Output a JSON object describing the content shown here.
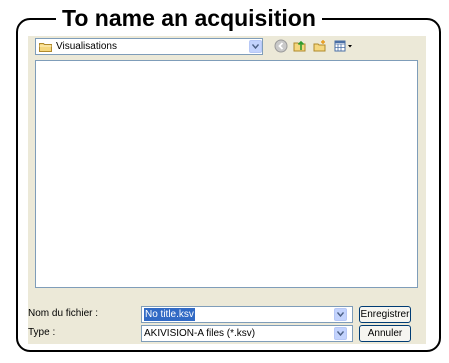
{
  "title": "To name an acquisition",
  "location": {
    "folder": "Visualisations",
    "folder_icon": "folder-icon"
  },
  "toolbar_icons": [
    "back-icon",
    "up-folder-icon",
    "new-folder-icon",
    "view-menu-icon"
  ],
  "file_name": {
    "label": "Nom du fichier :",
    "value": "No title.ksv"
  },
  "file_type": {
    "label": "Type :",
    "value": "AKIVISION-A files (*.ksv)"
  },
  "buttons": {
    "save": "Enregistrer",
    "cancel": "Annuler"
  },
  "colors": {
    "dialog_background": "#ece9d8",
    "selection": "#316ac5",
    "field_border": "#7f9db9"
  }
}
